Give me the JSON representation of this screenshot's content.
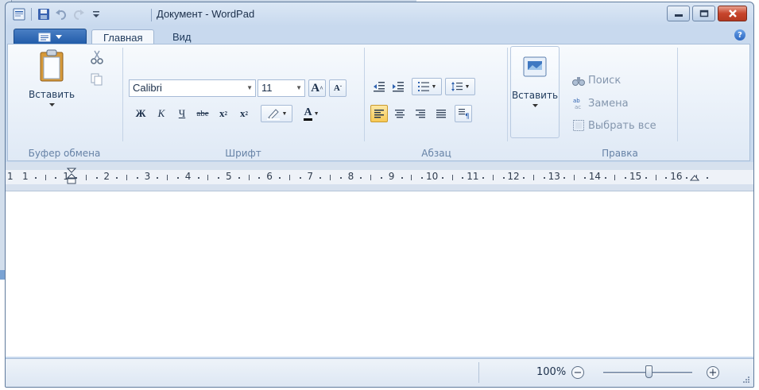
{
  "window": {
    "title": "Документ - WordPad"
  },
  "tabs": [
    {
      "label": "Главная",
      "active": true
    },
    {
      "label": "Вид",
      "active": false
    }
  ],
  "groups": {
    "clipboard": {
      "label": "Буфер обмена",
      "paste_label": "Вставить"
    },
    "font": {
      "label": "Шрифт",
      "font_family": "Calibri",
      "font_size": "11",
      "bold": "Ж",
      "italic": "К",
      "underline": "Ч",
      "strike": "abe"
    },
    "paragraph": {
      "label": "Абзац"
    },
    "insert": {
      "paste_label": "Вставить"
    },
    "editing": {
      "label": "Правка",
      "find": "Поиск",
      "replace": "Замена",
      "select_all": "Выбрать все"
    }
  },
  "ruler": {
    "labels": [
      "1",
      "1",
      "2",
      "3",
      "4",
      "5",
      "6",
      "7",
      "8",
      "9",
      "10",
      "11",
      "12",
      "13",
      "14",
      "15",
      "16"
    ]
  },
  "status": {
    "zoom": "100%"
  },
  "colors": {
    "accent": "#1f5aa8",
    "ribbon_bg": "#e6eef8",
    "highlight_active": "#f7c955"
  }
}
